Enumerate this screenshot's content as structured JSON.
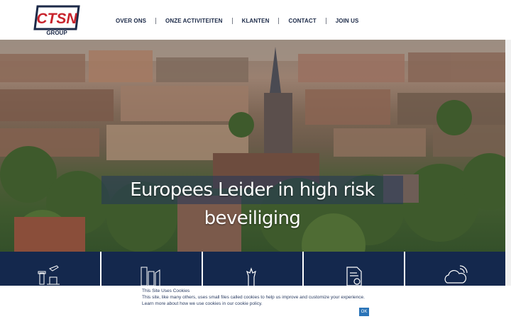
{
  "brand": {
    "logo_text": "CTSN",
    "logo_subtext": "GROUP",
    "logo_color": "#c8232c",
    "frame_color": "#1c2a48"
  },
  "nav": {
    "items": [
      {
        "label": "OVER ONS"
      },
      {
        "label": "ONZE ACTIVITEITEN"
      },
      {
        "label": "KLANTEN"
      },
      {
        "label": "CONTACT"
      },
      {
        "label": "JOIN US"
      }
    ]
  },
  "hero": {
    "title": "Europees Leider in high risk beveiliging",
    "scroll_icon": "double-chevron-down-icon"
  },
  "services": {
    "tile_color": "#14284d",
    "items": [
      {
        "icon": "airport-icon"
      },
      {
        "icon": "buildings-icon"
      },
      {
        "icon": "guard-dog-icon"
      },
      {
        "icon": "document-badge-icon"
      },
      {
        "icon": "cloud-signal-icon"
      }
    ]
  },
  "cookie_banner": {
    "title": "This Site Uses Cookies",
    "text": "This site, like many others, uses small files called cookies to help us improve and customize your experience.",
    "link_text": "Learn more about how we use cookies in our cookie policy.",
    "ok_label": "OK"
  }
}
